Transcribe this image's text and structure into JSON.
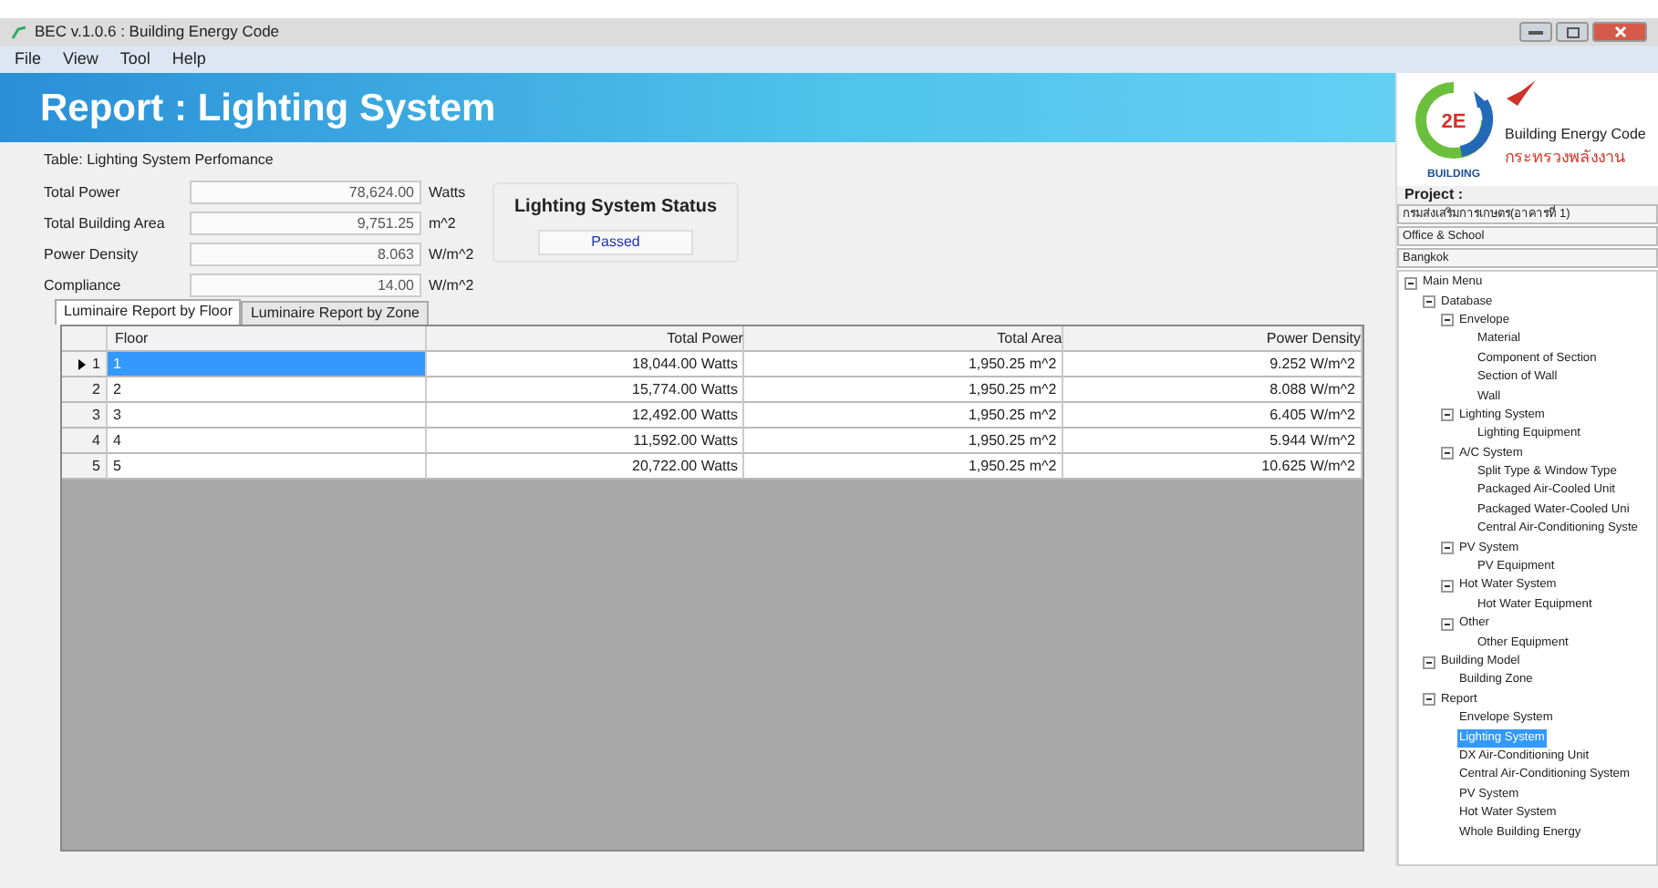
{
  "window": {
    "title": "BEC v.1.0.6 : Building Energy Code"
  },
  "menu": [
    "File",
    "View",
    "Tool",
    "Help"
  ],
  "banner": {
    "title": "Report : Lighting System"
  },
  "performance": {
    "caption": "Table: Lighting System Perfomance",
    "fields": [
      {
        "label": "Total Power",
        "value": "78,624.00",
        "unit": "Watts"
      },
      {
        "label": "Total Building Area",
        "value": "9,751.25",
        "unit": "m^2"
      },
      {
        "label": "Power Density",
        "value": "8.063",
        "unit": "W/m^2"
      },
      {
        "label": "Compliance",
        "value": "14.00",
        "unit": "W/m^2"
      }
    ],
    "status": {
      "title": "Lighting System Status",
      "value": "Passed"
    }
  },
  "tabs": [
    {
      "label": "Luminaire Report by Floor",
      "selected": true
    },
    {
      "label": "Luminaire Report by Zone",
      "selected": false
    }
  ],
  "grid": {
    "columns": [
      "Floor",
      "Total Power",
      "Total Area",
      "Power Density"
    ],
    "rows": [
      {
        "index": "1",
        "selected": true,
        "cells": [
          "1",
          "18,044.00 Watts",
          "1,950.25 m^2",
          "9.252 W/m^2"
        ]
      },
      {
        "index": "2",
        "selected": false,
        "cells": [
          "2",
          "15,774.00 Watts",
          "1,950.25 m^2",
          "8.088 W/m^2"
        ]
      },
      {
        "index": "3",
        "selected": false,
        "cells": [
          "3",
          "12,492.00 Watts",
          "1,950.25 m^2",
          "6.405 W/m^2"
        ]
      },
      {
        "index": "4",
        "selected": false,
        "cells": [
          "4",
          "11,592.00 Watts",
          "1,950.25 m^2",
          "5.944 W/m^2"
        ]
      },
      {
        "index": "5",
        "selected": false,
        "cells": [
          "5",
          "20,722.00 Watts",
          "1,950.25 m^2",
          "10.625 W/m^2"
        ]
      }
    ]
  },
  "logo": {
    "name": "Building Energy Code",
    "badge": "2E",
    "ring": "BUILDING",
    "ministry": "กระทรวงพลังงาน"
  },
  "project": {
    "label": "Project :",
    "fields": [
      "กรมส่งเสริมการเกษตร(อาคารที่ 1)",
      "Office & School",
      "Bangkok"
    ]
  },
  "tree": [
    {
      "label": "Main Menu",
      "expanded": true,
      "selected": false,
      "children": [
        {
          "label": "Database",
          "expanded": true,
          "selected": false,
          "children": [
            {
              "label": "Envelope",
              "expanded": true,
              "selected": false,
              "children": [
                {
                  "label": "Material",
                  "selected": false
                },
                {
                  "label": "Component of Section",
                  "selected": false
                },
                {
                  "label": "Section of Wall",
                  "selected": false
                },
                {
                  "label": "Wall",
                  "selected": false
                }
              ]
            },
            {
              "label": "Lighting System",
              "expanded": true,
              "selected": false,
              "children": [
                {
                  "label": "Lighting Equipment",
                  "selected": false
                }
              ]
            },
            {
              "label": "A/C System",
              "expanded": true,
              "selected": false,
              "children": [
                {
                  "label": "Split Type & Window Type",
                  "selected": false
                },
                {
                  "label": "Packaged Air-Cooled Unit",
                  "selected": false
                },
                {
                  "label": "Packaged Water-Cooled Uni",
                  "selected": false
                },
                {
                  "label": "Central Air-Conditioning Syste",
                  "selected": false
                }
              ]
            },
            {
              "label": "PV System",
              "expanded": true,
              "selected": false,
              "children": [
                {
                  "label": "PV Equipment",
                  "selected": false
                }
              ]
            },
            {
              "label": "Hot Water System",
              "expanded": true,
              "selected": false,
              "children": [
                {
                  "label": "Hot Water Equipment",
                  "selected": false
                }
              ]
            },
            {
              "label": "Other",
              "expanded": true,
              "selected": false,
              "children": [
                {
                  "label": "Other Equipment",
                  "selected": false
                }
              ]
            }
          ]
        },
        {
          "label": "Building Model",
          "expanded": true,
          "selected": false,
          "children": [
            {
              "label": "Building Zone",
              "selected": false
            }
          ]
        },
        {
          "label": "Report",
          "expanded": true,
          "selected": false,
          "children": [
            {
              "label": "Envelope System",
              "selected": false
            },
            {
              "label": "Lighting System",
              "selected": true
            },
            {
              "label": "DX Air-Conditioning Unit",
              "selected": false
            },
            {
              "label": "Central Air-Conditioning System",
              "selected": false
            },
            {
              "label": "PV System",
              "selected": false
            },
            {
              "label": "Hot Water System",
              "selected": false
            },
            {
              "label": "Whole Building Energy",
              "selected": false
            }
          ]
        }
      ]
    }
  ]
}
